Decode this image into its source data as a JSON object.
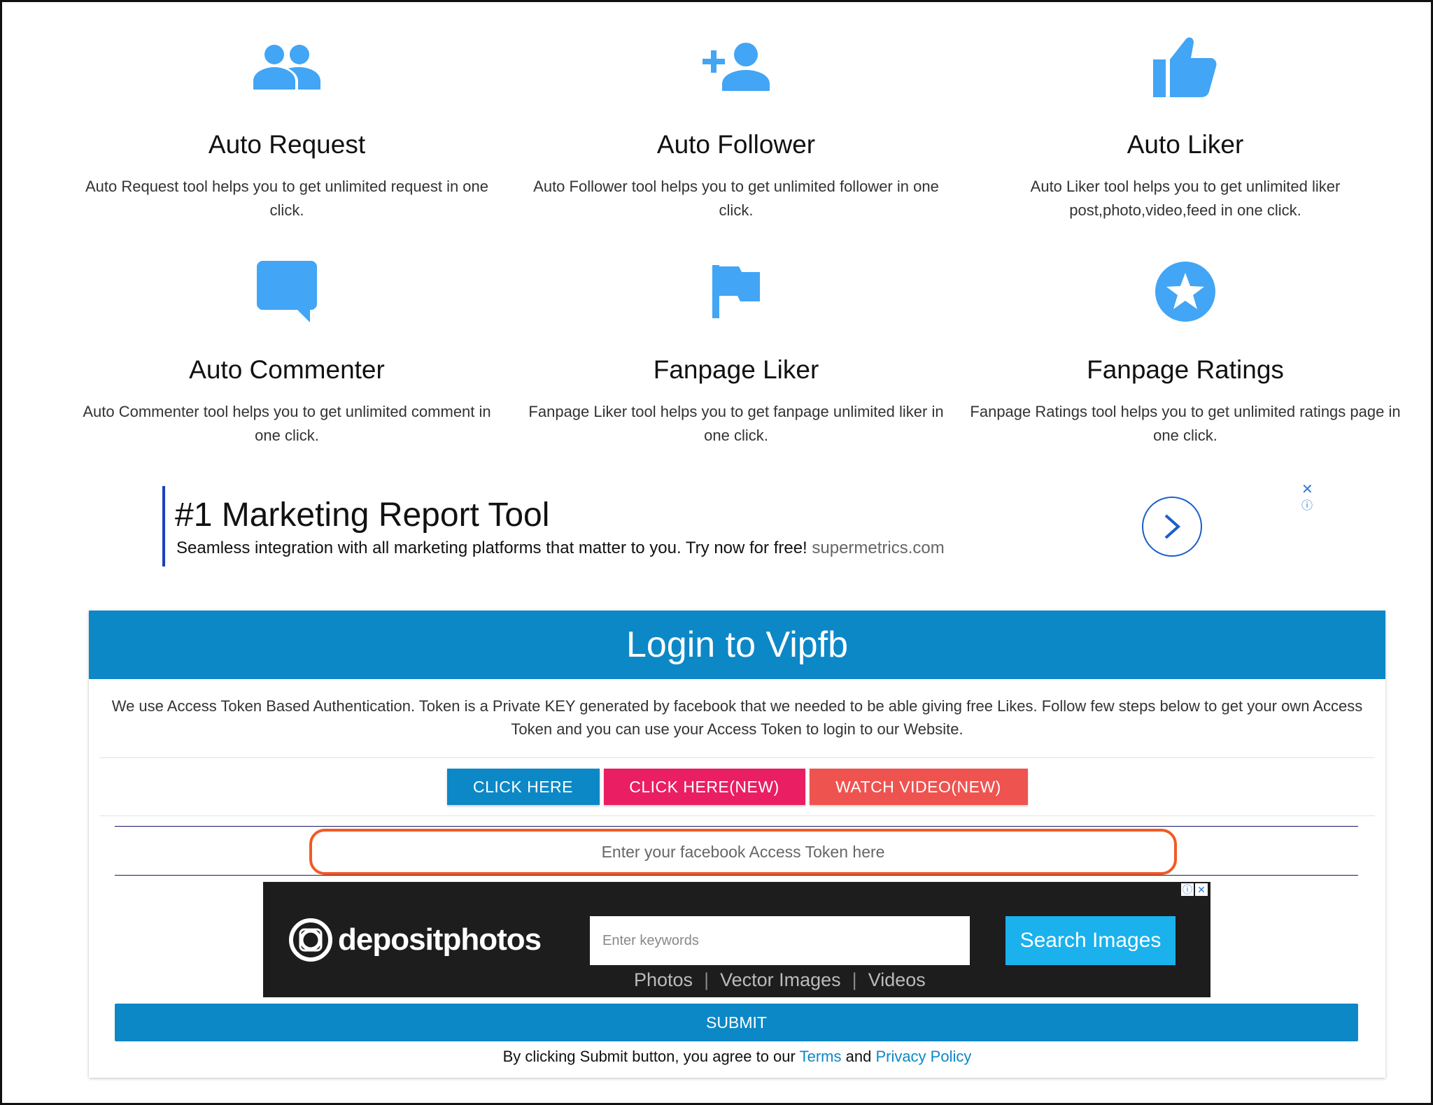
{
  "features": [
    {
      "icon": "group-icon",
      "title": "Auto Request",
      "desc": "Auto Request tool helps you to get unlimited request in one click."
    },
    {
      "icon": "add-person-icon",
      "title": "Auto Follower",
      "desc": "Auto Follower tool helps you to get unlimited follower in one click."
    },
    {
      "icon": "thumbs-up-icon",
      "title": "Auto Liker",
      "desc": "Auto Liker tool helps you to get unlimited liker post,photo,video,feed in one click."
    },
    {
      "icon": "comment-icon",
      "title": "Auto Commenter",
      "desc": "Auto Commenter tool helps you to get unlimited comment in one click."
    },
    {
      "icon": "flag-icon",
      "title": "Fanpage Liker",
      "desc": "Fanpage Liker tool helps you to get fanpage unlimited liker in one click."
    },
    {
      "icon": "star-circle-icon",
      "title": "Fanpage Ratings",
      "desc": "Fanpage Ratings tool helps you to get unlimited ratings page in one click."
    }
  ],
  "ad": {
    "title": "#1 Marketing Report Tool",
    "desc": "Seamless integration with all marketing platforms that matter to you. Try now for free!",
    "domain": "supermetrics.com"
  },
  "login": {
    "title": "Login to Vipfb",
    "text": "We use Access Token Based Authentication. Token is a Private KEY generated by facebook that we needed to be able giving free Likes. Follow few steps below to get your own Access Token and you can use your Access Token to login to our Website.",
    "buttons": [
      "CLICK HERE",
      "CLICK HERE(NEW)",
      "WATCH VIDEO(NEW)"
    ],
    "token_placeholder": "Enter your facebook Access Token here",
    "submit": "SUBMIT",
    "agree_prefix": "By clicking Submit button, you agree to our",
    "terms": "Terms",
    "and": "and",
    "privacy": "Privacy Policy"
  },
  "dp_ad": {
    "brand": "depositphotos",
    "placeholder": "Enter keywords",
    "search_btn": "Search Images",
    "links": [
      "Photos",
      "Vector Images",
      "Videos"
    ]
  },
  "colors": {
    "accent": "#0c88c7",
    "icon": "#42a5f5",
    "pink": "#e91e63",
    "red": "#ef5350",
    "highlight": "#f15a24"
  }
}
